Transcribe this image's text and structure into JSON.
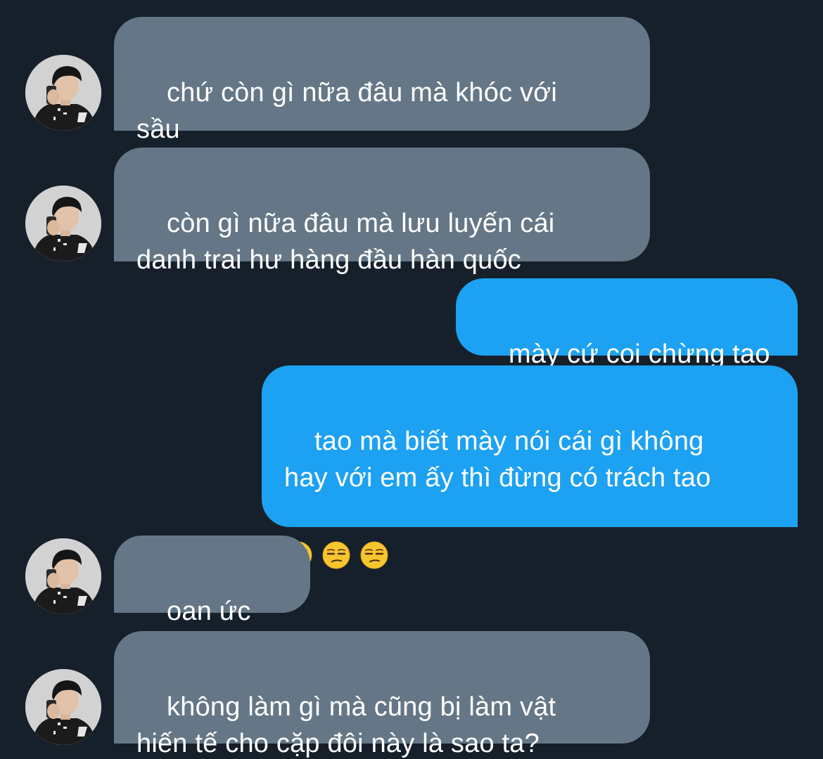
{
  "messages": [
    {
      "side": "in",
      "text": "chứ còn gì nữa đâu mà khóc với\nsầu"
    },
    {
      "side": "in",
      "text": "còn gì nữa đâu mà lưu luyến cái\ndanh trai hư hàng đầu hàn quốc"
    },
    {
      "side": "out",
      "text": "mày cứ coi chừng tao"
    },
    {
      "side": "out",
      "text": "tao mà biết mày nói cái gì không\nhay với em ấy thì đừng có trách tao",
      "emojis": [
        "unamused-face",
        "unamused-face",
        "unamused-face"
      ]
    },
    {
      "side": "in",
      "text": "oan ức quá"
    },
    {
      "side": "in",
      "text": "không làm gì mà cũng bị làm vật\nhiến tế cho cặp đôi này là sao ta?"
    }
  ],
  "colors": {
    "background": "#15202b",
    "incoming_bubble": "#657786",
    "outgoing_bubble": "#1da1f2",
    "text": "#ffffff"
  },
  "icons": {
    "avatar": "contact-avatar-photo",
    "emoji": "unamused-face"
  }
}
